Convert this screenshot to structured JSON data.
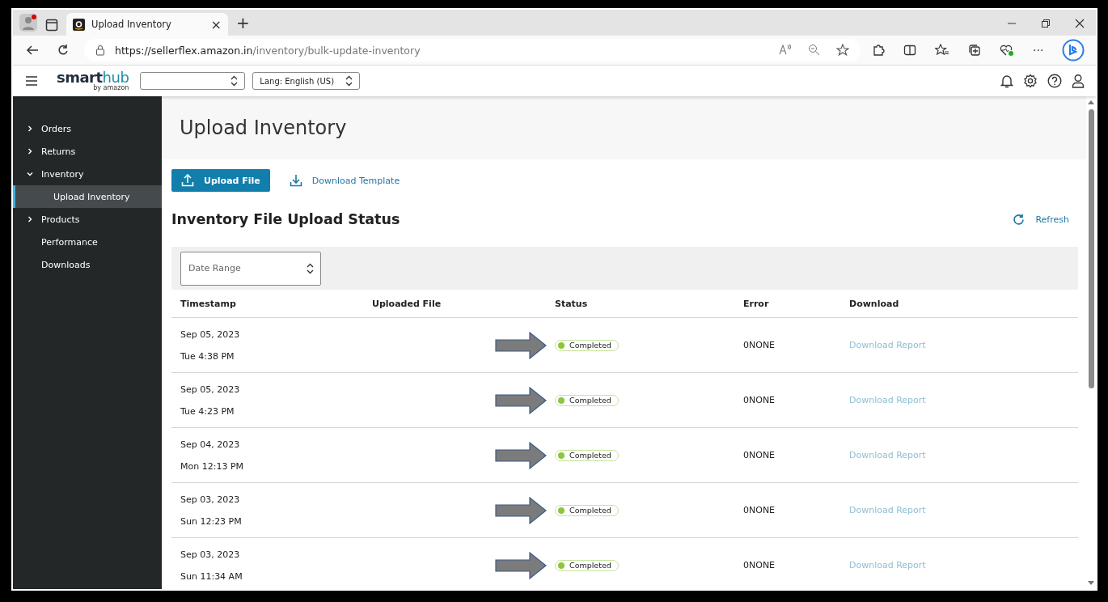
{
  "browser": {
    "tab_title": "Upload Inventory",
    "tab_close": "×",
    "new_tab": "+",
    "url_host": "https://sellerflex.amazon.in",
    "url_path": "/inventory/bulk-update-inventory",
    "more": "···"
  },
  "header": {
    "logo_main": "smart",
    "logo_accent": "hub",
    "logo_sub": "by amazon",
    "language": "Lang: English (US)"
  },
  "sidebar": {
    "items": [
      {
        "label": "Orders",
        "kind": "group",
        "expanded": false,
        "selected": false
      },
      {
        "label": "Returns",
        "kind": "group",
        "expanded": false,
        "selected": false
      },
      {
        "label": "Inventory",
        "kind": "group",
        "expanded": true,
        "selected": false,
        "children": [
          {
            "label": "Upload Inventory",
            "selected": true
          }
        ]
      },
      {
        "label": "Products",
        "kind": "group",
        "expanded": false,
        "selected": false
      },
      {
        "label": "Performance",
        "kind": "link",
        "selected": false
      },
      {
        "label": "Downloads",
        "kind": "link",
        "selected": false
      }
    ]
  },
  "page": {
    "title": "Upload Inventory",
    "upload_button": "Upload File",
    "template_link": "Download Template",
    "section_title": "Inventory File Upload Status",
    "refresh": "Refresh",
    "date_filter": {
      "placeholder": "Date Range"
    }
  },
  "table": {
    "columns": [
      "Timestamp",
      "Uploaded File",
      "Status",
      "Error",
      "Download"
    ],
    "rows": [
      {
        "date": "Sep 05, 2023",
        "time": "Tue 4:38 PM",
        "status": "Completed",
        "error": "0NONE",
        "download": "Download Report"
      },
      {
        "date": "Sep 05, 2023",
        "time": "Tue 4:23 PM",
        "status": "Completed",
        "error": "0NONE",
        "download": "Download Report"
      },
      {
        "date": "Sep 04, 2023",
        "time": "Mon 12:13 PM",
        "status": "Completed",
        "error": "0NONE",
        "download": "Download Report"
      },
      {
        "date": "Sep 03, 2023",
        "time": "Sun 12:23 PM",
        "status": "Completed",
        "error": "0NONE",
        "download": "Download Report"
      },
      {
        "date": "Sep 03, 2023",
        "time": "Sun 11:34 AM",
        "status": "Completed",
        "error": "0NONE",
        "download": "Download Report"
      }
    ]
  }
}
